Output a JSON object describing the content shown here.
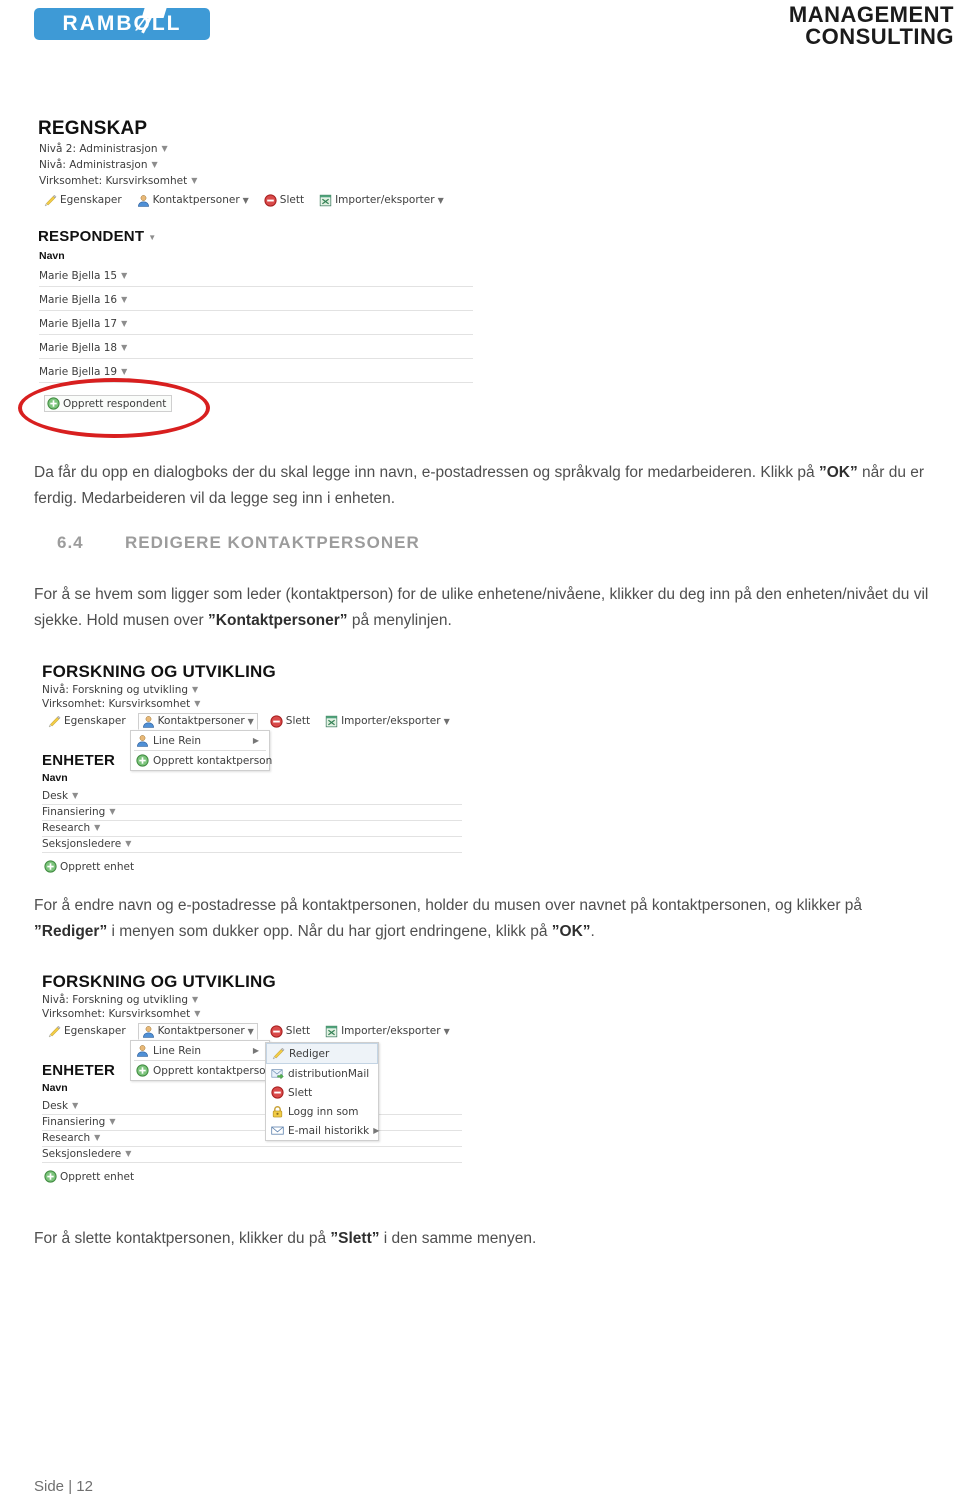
{
  "header": {
    "logo_text": "RAMBØLL",
    "brand_line1": "MANAGEMENT",
    "brand_line2": "CONSULTING",
    "logo_bg_color": "#3e9ad6"
  },
  "screenshot1": {
    "app_title": "REGNSKAP",
    "breadcrumbs": [
      "Nivå 2: Administrasjon",
      "Nivå: Administrasjon",
      "Virksomhet: Kursvirksomhet"
    ],
    "menu": [
      {
        "label": "Egenskaper",
        "icon": "pencil-icon",
        "has_arrow": false
      },
      {
        "label": "Kontaktpersoner",
        "icon": "contact-person-icon",
        "has_arrow": true
      },
      {
        "label": "Slett",
        "icon": "delete-icon",
        "has_arrow": false
      },
      {
        "label": "Importer/eksporter",
        "icon": "excel-icon",
        "has_arrow": true
      }
    ],
    "section_title": "RESPONDENT",
    "column_header": "Navn",
    "rows": [
      "Marie Bjella 15",
      "Marie Bjella 16",
      "Marie Bjella 17",
      "Marie Bjella 18",
      "Marie Bjella 19"
    ],
    "create_button": "Opprett respondent",
    "annotation_color": "#d81f1f"
  },
  "para1": {
    "line1_a": "Da får du opp en dialogboks der du skal legge inn navn, e-postadressen og språkvalg for medarbeideren. Klikk på",
    "quoted": "”OK”",
    "line2_b": " når du er ferdig. Medarbeideren vil da legge seg inn i enheten."
  },
  "heading": {
    "number": "6.4",
    "text": "REDIGERE KONTAKTPERSONER"
  },
  "para2": {
    "a": "For å se hvem som ligger som leder (kontaktperson) for de ulike enhetene/nivåene, klikker du deg inn på den enheten/nivået du vil sjekke. Hold musen over ",
    "quoted": "”Kontaktpersoner”",
    "b": " på menylinjen."
  },
  "screenshot2": {
    "app_title": "FORSKNING OG UTVIKLING",
    "breadcrumbs": [
      "Nivå: Forskning og utvikling",
      "Virksomhet: Kursvirksomhet"
    ],
    "menu": [
      {
        "label": "Egenskaper",
        "icon": "pencil-icon",
        "has_arrow": false
      },
      {
        "label": "Kontaktpersoner",
        "icon": "contact-person-icon",
        "has_arrow": true
      },
      {
        "label": "Slett",
        "icon": "delete-icon",
        "has_arrow": false
      },
      {
        "label": "Importer/eksporter",
        "icon": "excel-icon",
        "has_arrow": true
      }
    ],
    "dropdown": {
      "person": "Line Rein",
      "create": "Opprett kontaktperson"
    },
    "section_title": "ENHETER",
    "column_header": "Navn",
    "rows": [
      "Desk",
      "Finansiering",
      "Research",
      "Seksjonsledere"
    ],
    "create_button": "Opprett enhet"
  },
  "para3": {
    "a": "For å endre navn og e-postadresse på kontaktpersonen, holder du musen over navnet på kontaktpersonen, og klikker på ",
    "quoted1": "”Rediger”",
    "b": " i menyen som dukker opp. Når du har gjort endringene, klikk på ",
    "quoted2": "”OK”",
    "c": "."
  },
  "screenshot3": {
    "app_title": "FORSKNING OG UTVIKLING",
    "breadcrumbs": [
      "Nivå: Forskning og utvikling",
      "Virksomhet: Kursvirksomhet"
    ],
    "menu": [
      {
        "label": "Egenskaper",
        "icon": "pencil-icon",
        "has_arrow": false
      },
      {
        "label": "Kontaktpersoner",
        "icon": "contact-person-icon",
        "has_arrow": true
      },
      {
        "label": "Slett",
        "icon": "delete-icon",
        "has_arrow": false
      },
      {
        "label": "Importer/eksporter",
        "icon": "excel-icon",
        "has_arrow": true
      }
    ],
    "dropdown": {
      "person": "Line Rein",
      "create": "Opprett kontaktperson"
    },
    "submenu": [
      {
        "label": "Rediger",
        "icon": "pencil-icon",
        "has_arrow": false
      },
      {
        "label": "distributionMail",
        "icon": "mail-send-icon",
        "has_arrow": false
      },
      {
        "label": "Slett",
        "icon": "delete-icon",
        "has_arrow": false
      },
      {
        "label": "Logg inn som",
        "icon": "lock-icon",
        "has_arrow": false
      },
      {
        "label": "E-mail historikk",
        "icon": "envelope-icon",
        "has_arrow": true
      }
    ],
    "section_title": "ENHETER",
    "column_header": "Navn",
    "rows": [
      "Desk",
      "Finansiering",
      "Research",
      "Seksjonsledere"
    ],
    "create_button": "Opprett enhet"
  },
  "para4": {
    "a": "For å slette kontaktpersonen, klikker du på ",
    "quoted": "”Slett”",
    "b": " i den samme menyen."
  },
  "footer": {
    "page_label": "Side | 12"
  }
}
